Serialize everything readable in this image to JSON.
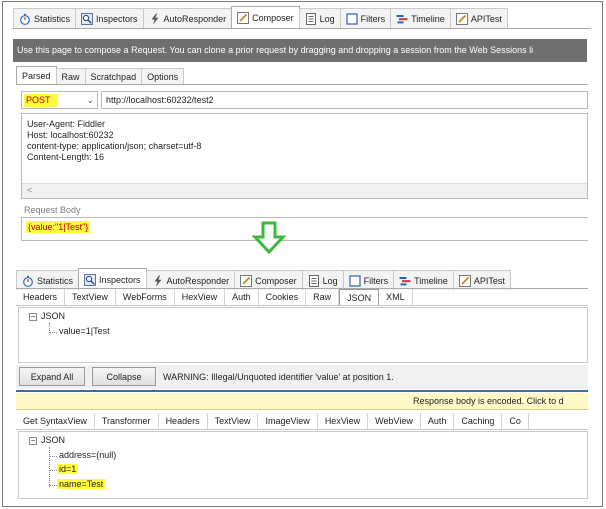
{
  "top_tabs": [
    {
      "label": "Statistics",
      "icon": "stopwatch-icon"
    },
    {
      "label": "Inspectors",
      "icon": "magnifier-icon"
    },
    {
      "label": "AutoResponder",
      "icon": "lightning-icon"
    },
    {
      "label": "Composer",
      "icon": "pencil-icon"
    },
    {
      "label": "Log",
      "icon": "log-icon"
    },
    {
      "label": "Filters",
      "icon": "checkbox-icon"
    },
    {
      "label": "Timeline",
      "icon": "timeline-icon"
    },
    {
      "label": "APITest",
      "icon": "pencil-icon"
    }
  ],
  "composer": {
    "banner": "Use this page to compose a Request. You can clone a prior request by dragging and dropping a session from the Web Sessions li",
    "sub_tabs": [
      "Parsed",
      "Raw",
      "Scratchpad",
      "Options"
    ],
    "method": "POST",
    "url": "http://localhost:60232/test2",
    "headers": [
      "User-Agent: Fiddler",
      "Host: localhost:60232",
      "content-type: application/json; charset=utf-8",
      "Content-Length: 16"
    ],
    "scroll_left": "<",
    "request_body_label": "Request Body",
    "request_body": "{value:\"1|Test\"}"
  },
  "bottom_tabs": [
    {
      "label": "Statistics",
      "icon": "stopwatch-icon"
    },
    {
      "label": "Inspectors",
      "icon": "magnifier-icon"
    },
    {
      "label": "AutoResponder",
      "icon": "lightning-icon"
    },
    {
      "label": "Composer",
      "icon": "pencil-icon"
    },
    {
      "label": "Log",
      "icon": "log-icon"
    },
    {
      "label": "Filters",
      "icon": "checkbox-icon"
    },
    {
      "label": "Timeline",
      "icon": "timeline-icon"
    },
    {
      "label": "APITest",
      "icon": "pencil-icon"
    }
  ],
  "request_inspector": {
    "tabs": [
      "Headers",
      "TextView",
      "WebForms",
      "HexView",
      "Auth",
      "Cookies",
      "Raw",
      "JSON",
      "XML"
    ],
    "tree_root": "JSON",
    "tree_child": "value=1|Test",
    "expand_all": "Expand All",
    "collapse": "Collapse",
    "warning": "WARNING: Illegal/Unquoted identifier 'value' at position 1."
  },
  "response_inspector": {
    "encoded_notice": "Response body is encoded. Click to d",
    "tabs": [
      "Get SyntaxView",
      "Transformer",
      "Headers",
      "TextView",
      "ImageView",
      "HexView",
      "WebView",
      "Auth",
      "Caching",
      "Co"
    ],
    "tree_root": "JSON",
    "tree_children": [
      "address=(null)",
      "id=1",
      "name=Test"
    ]
  },
  "colors": {
    "highlight": "#fffb3c",
    "arrow": "#3db83d",
    "banner": "#6f6f6f",
    "notice": "#fff9c7"
  }
}
